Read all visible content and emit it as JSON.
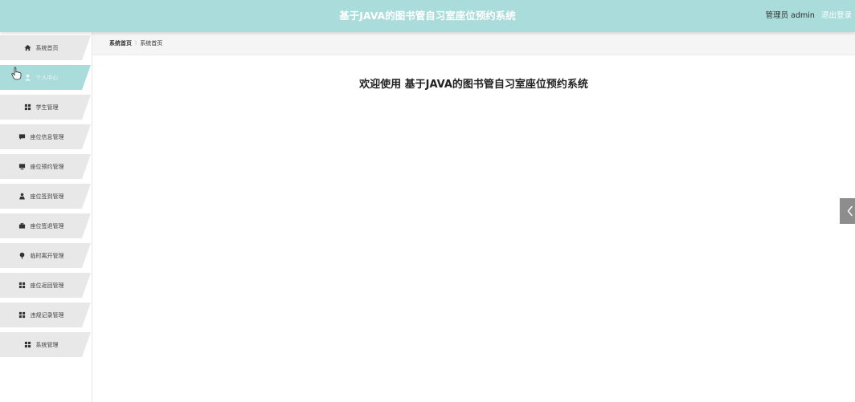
{
  "header": {
    "title": "基于JAVA的图书管自习室座位预约系统",
    "user_label": "管理员 admin",
    "logout_label": "退出登录"
  },
  "sidebar": {
    "items": [
      {
        "label": "系统首页",
        "icon": "home-icon"
      },
      {
        "label": "个人中心",
        "icon": "user-icon",
        "active": true
      },
      {
        "label": "学生管理",
        "icon": "grid-icon"
      },
      {
        "label": "座位信息管理",
        "icon": "chat-icon"
      },
      {
        "label": "座位预约管理",
        "icon": "monitor-icon"
      },
      {
        "label": "座位签到管理",
        "icon": "person-icon"
      },
      {
        "label": "座位签退管理",
        "icon": "briefcase-icon"
      },
      {
        "label": "临时离开管理",
        "icon": "pin-icon"
      },
      {
        "label": "座位返回管理",
        "icon": "grid-icon"
      },
      {
        "label": "违规记录管理",
        "icon": "grid-icon"
      },
      {
        "label": "系统管理",
        "icon": "grid-icon"
      }
    ]
  },
  "breadcrumb": {
    "first": "系统首页",
    "separator": "⁝",
    "current": "系统首页"
  },
  "main": {
    "welcome": "欢迎使用 基于JAVA的图书管自习室座位预约系统"
  },
  "colors": {
    "header_bg": "#a9dcda",
    "active_item": "#a9dcda",
    "menu_item": "#e8e8e8"
  }
}
